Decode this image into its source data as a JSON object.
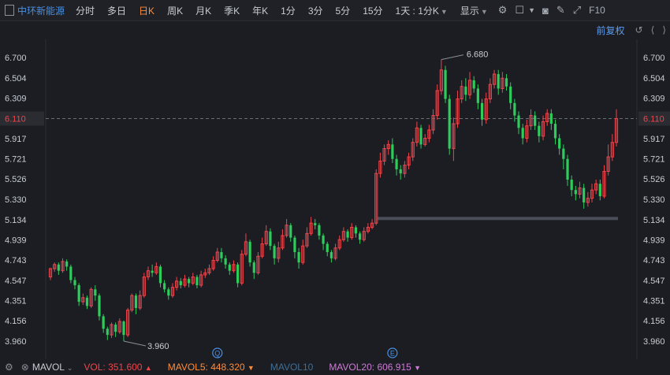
{
  "toolbar": {
    "stock_name": "中环新能源",
    "items": [
      "分时",
      "多日",
      "日K",
      "周K",
      "月K",
      "季K",
      "年K",
      "1分",
      "3分",
      "5分",
      "15分",
      "1天 : 1分K"
    ],
    "active_index": 2,
    "display_label": "显示",
    "f10_label": "F10"
  },
  "adjust_label": "前复权",
  "colors": {
    "up": "#f0444b",
    "down": "#2ecc5a",
    "accent": "#ff8c3a",
    "background": "#1b1d22",
    "price_line": "#f0444b"
  },
  "chart_data": {
    "type": "candlestick",
    "ylim": [
      3.86,
      6.8
    ],
    "y_ticks": [
      "6.700",
      "6.504",
      "6.309",
      "6.110",
      "5.917",
      "5.721",
      "5.526",
      "5.330",
      "5.134",
      "4.939",
      "4.743",
      "4.547",
      "4.351",
      "4.156",
      "3.960"
    ],
    "current_price": "6.110",
    "annotations": {
      "max": "6.680",
      "min": "3.960"
    },
    "event_markers": [
      "Q",
      "E"
    ],
    "resistance_level": 5.145,
    "candles": [
      [
        4.58,
        4.66,
        4.67,
        4.55
      ],
      [
        4.66,
        4.7,
        4.72,
        4.63
      ],
      [
        4.7,
        4.64,
        4.72,
        4.6
      ],
      [
        4.64,
        4.73,
        4.76,
        4.62
      ],
      [
        4.73,
        4.68,
        4.75,
        4.64
      ],
      [
        4.68,
        4.55,
        4.7,
        4.52
      ],
      [
        4.55,
        4.5,
        4.58,
        4.46
      ],
      [
        4.5,
        4.34,
        4.52,
        4.3
      ],
      [
        4.34,
        4.38,
        4.42,
        4.31
      ],
      [
        4.38,
        4.3,
        4.4,
        4.27
      ],
      [
        4.3,
        4.46,
        4.48,
        4.28
      ],
      [
        4.46,
        4.4,
        4.5,
        4.35
      ],
      [
        4.4,
        4.2,
        4.42,
        4.16
      ],
      [
        4.2,
        4.08,
        4.22,
        4.04
      ],
      [
        4.08,
        4.02,
        4.1,
        3.97
      ],
      [
        4.02,
        4.12,
        4.14,
        3.99
      ],
      [
        4.12,
        4.05,
        4.14,
        4.0
      ],
      [
        4.05,
        4.15,
        4.18,
        4.03
      ],
      [
        4.15,
        4.02,
        4.16,
        3.96
      ],
      [
        4.02,
        4.26,
        4.28,
        4.0
      ],
      [
        4.26,
        4.4,
        4.42,
        4.24
      ],
      [
        4.4,
        4.28,
        4.42,
        4.22
      ],
      [
        4.28,
        4.4,
        4.45,
        4.26
      ],
      [
        4.4,
        4.58,
        4.62,
        4.38
      ],
      [
        4.58,
        4.64,
        4.68,
        4.55
      ],
      [
        4.64,
        4.62,
        4.7,
        4.58
      ],
      [
        4.62,
        4.68,
        4.72,
        4.6
      ],
      [
        4.68,
        4.52,
        4.7,
        4.48
      ],
      [
        4.52,
        4.46,
        4.55,
        4.43
      ],
      [
        4.46,
        4.4,
        4.48,
        4.36
      ],
      [
        4.4,
        4.48,
        4.52,
        4.38
      ],
      [
        4.48,
        4.54,
        4.58,
        4.45
      ],
      [
        4.54,
        4.5,
        4.57,
        4.47
      ],
      [
        4.5,
        4.56,
        4.6,
        4.48
      ],
      [
        4.56,
        4.52,
        4.58,
        4.48
      ],
      [
        4.52,
        4.58,
        4.62,
        4.5
      ],
      [
        4.58,
        4.5,
        4.6,
        4.47
      ],
      [
        4.5,
        4.6,
        4.64,
        4.48
      ],
      [
        4.6,
        4.62,
        4.66,
        4.57
      ],
      [
        4.62,
        4.66,
        4.7,
        4.6
      ],
      [
        4.66,
        4.74,
        4.78,
        4.64
      ],
      [
        4.74,
        4.82,
        4.86,
        4.72
      ],
      [
        4.82,
        4.76,
        4.86,
        4.72
      ],
      [
        4.76,
        4.7,
        4.79,
        4.66
      ],
      [
        4.7,
        4.64,
        4.72,
        4.6
      ],
      [
        4.64,
        4.7,
        4.74,
        4.62
      ],
      [
        4.7,
        4.52,
        4.72,
        4.48
      ],
      [
        4.52,
        4.8,
        4.84,
        4.5
      ],
      [
        4.8,
        4.92,
        5.0,
        4.78
      ],
      [
        4.92,
        4.72,
        4.94,
        4.68
      ],
      [
        4.72,
        4.62,
        4.74,
        4.56
      ],
      [
        4.62,
        4.78,
        4.82,
        4.6
      ],
      [
        4.78,
        4.9,
        4.96,
        4.76
      ],
      [
        4.9,
        5.02,
        5.08,
        4.88
      ],
      [
        5.02,
        4.88,
        5.05,
        4.84
      ],
      [
        4.88,
        4.76,
        4.9,
        4.7
      ],
      [
        4.76,
        4.86,
        4.92,
        4.72
      ],
      [
        4.86,
        4.98,
        5.04,
        4.84
      ],
      [
        4.98,
        5.08,
        5.14,
        4.96
      ],
      [
        5.08,
        4.96,
        5.1,
        4.92
      ],
      [
        4.96,
        4.82,
        4.98,
        4.76
      ],
      [
        4.82,
        4.72,
        4.86,
        4.66
      ],
      [
        4.72,
        4.88,
        4.94,
        4.7
      ],
      [
        4.88,
        5.0,
        5.06,
        4.86
      ],
      [
        5.0,
        5.1,
        5.16,
        4.98
      ],
      [
        5.1,
        5.08,
        5.14,
        5.04
      ],
      [
        5.08,
        4.98,
        5.1,
        4.94
      ],
      [
        4.98,
        4.9,
        5.0,
        4.84
      ],
      [
        4.9,
        4.82,
        4.92,
        4.78
      ],
      [
        4.82,
        4.76,
        4.84,
        4.72
      ],
      [
        4.76,
        4.86,
        4.9,
        4.74
      ],
      [
        4.86,
        4.94,
        4.98,
        4.84
      ],
      [
        4.94,
        5.02,
        5.06,
        4.92
      ],
      [
        5.02,
        4.96,
        5.04,
        4.92
      ],
      [
        4.96,
        5.06,
        5.1,
        4.94
      ],
      [
        5.06,
        5.0,
        5.08,
        4.96
      ],
      [
        5.0,
        4.94,
        5.02,
        4.9
      ],
      [
        4.94,
        5.02,
        5.06,
        4.92
      ],
      [
        5.02,
        5.06,
        5.1,
        5.0
      ],
      [
        5.06,
        5.1,
        5.14,
        5.04
      ],
      [
        5.1,
        5.58,
        5.62,
        5.08
      ],
      [
        5.58,
        5.7,
        5.78,
        5.54
      ],
      [
        5.7,
        5.82,
        5.86,
        5.66
      ],
      [
        5.82,
        5.86,
        5.9,
        5.76
      ],
      [
        5.86,
        5.72,
        5.92,
        5.68
      ],
      [
        5.72,
        5.62,
        5.76,
        5.56
      ],
      [
        5.62,
        5.58,
        5.66,
        5.52
      ],
      [
        5.58,
        5.66,
        5.7,
        5.54
      ],
      [
        5.66,
        5.74,
        5.78,
        5.62
      ],
      [
        5.74,
        5.88,
        5.92,
        5.7
      ],
      [
        5.88,
        6.02,
        6.08,
        5.84
      ],
      [
        6.02,
        5.86,
        6.05,
        5.82
      ],
      [
        5.86,
        5.92,
        5.96,
        5.84
      ],
      [
        5.92,
        6.0,
        6.05,
        5.88
      ],
      [
        6.0,
        6.14,
        6.2,
        5.96
      ],
      [
        6.14,
        6.38,
        6.44,
        6.1
      ],
      [
        6.38,
        6.58,
        6.68,
        6.34
      ],
      [
        6.58,
        6.3,
        6.62,
        6.26
      ],
      [
        6.3,
        5.82,
        6.34,
        5.76
      ],
      [
        5.82,
        6.06,
        6.12,
        5.7
      ],
      [
        6.06,
        6.3,
        6.38,
        6.02
      ],
      [
        6.3,
        6.42,
        6.48,
        6.26
      ],
      [
        6.42,
        6.34,
        6.5,
        6.28
      ],
      [
        6.34,
        6.48,
        6.56,
        6.3
      ],
      [
        6.48,
        6.4,
        6.52,
        6.36
      ],
      [
        6.4,
        6.26,
        6.44,
        6.2
      ],
      [
        6.26,
        6.1,
        6.3,
        6.04
      ],
      [
        6.1,
        6.3,
        6.36,
        6.06
      ],
      [
        6.3,
        6.44,
        6.5,
        6.26
      ],
      [
        6.44,
        6.54,
        6.58,
        6.4
      ],
      [
        6.54,
        6.4,
        6.58,
        6.34
      ],
      [
        6.4,
        6.5,
        6.56,
        6.36
      ],
      [
        6.5,
        6.42,
        6.54,
        6.38
      ],
      [
        6.42,
        6.26,
        6.46,
        6.2
      ],
      [
        6.26,
        6.14,
        6.3,
        6.08
      ],
      [
        6.14,
        6.02,
        6.18,
        5.96
      ],
      [
        6.02,
        5.92,
        6.06,
        5.86
      ],
      [
        5.92,
        6.04,
        6.1,
        5.88
      ],
      [
        6.04,
        6.14,
        6.2,
        6.0
      ],
      [
        6.14,
        6.04,
        6.18,
        6.0
      ],
      [
        6.04,
        5.94,
        6.08,
        5.88
      ],
      [
        5.94,
        6.08,
        6.14,
        5.9
      ],
      [
        6.08,
        6.16,
        6.2,
        6.04
      ],
      [
        6.16,
        6.06,
        6.2,
        6.0
      ],
      [
        6.06,
        5.92,
        6.1,
        5.86
      ],
      [
        5.92,
        5.82,
        5.96,
        5.76
      ],
      [
        5.82,
        5.72,
        5.86,
        5.62
      ],
      [
        5.72,
        5.52,
        5.76,
        5.46
      ],
      [
        5.52,
        5.42,
        5.56,
        5.36
      ],
      [
        5.42,
        5.38,
        5.46,
        5.32
      ],
      [
        5.38,
        5.44,
        5.5,
        5.34
      ],
      [
        5.44,
        5.3,
        5.48,
        5.24
      ],
      [
        5.3,
        5.34,
        5.4,
        5.26
      ],
      [
        5.34,
        5.42,
        5.48,
        5.3
      ],
      [
        5.42,
        5.48,
        5.52,
        5.38
      ],
      [
        5.48,
        5.36,
        5.52,
        5.32
      ],
      [
        5.36,
        5.6,
        5.66,
        5.34
      ],
      [
        5.6,
        5.74,
        5.86,
        5.56
      ],
      [
        5.74,
        5.88,
        5.96,
        5.7
      ],
      [
        5.88,
        6.11,
        6.2,
        5.84
      ]
    ]
  },
  "bottom": {
    "mavol_label": "MAVOL",
    "vol": {
      "text": "VOL: 351.600",
      "color": "#f0444b",
      "arrow": "▲"
    },
    "mavol5": {
      "text": "MAVOL5: 448.320",
      "color": "#ff8c3a",
      "arrow": "▼"
    },
    "mavol10": {
      "text": "MAVOL10",
      "color": "#3d6f99",
      "arrow": ""
    },
    "mavol20": {
      "text": "MAVOL20: 606.915",
      "color": "#d07ad8",
      "arrow": "▼"
    }
  }
}
